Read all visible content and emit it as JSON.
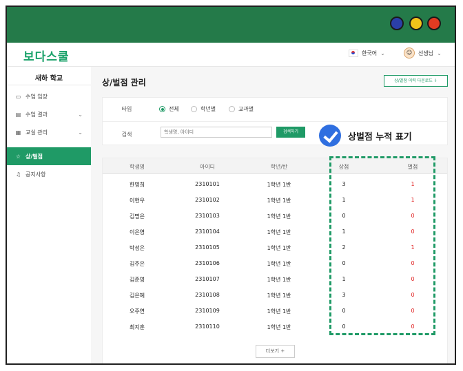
{
  "app": {
    "logo": "보다스쿨"
  },
  "header": {
    "language": "한국어",
    "user": "선생님"
  },
  "sidebar": {
    "school": "새하 학교",
    "items": [
      {
        "label": "수업 입장",
        "icon": "monitor-icon",
        "arrow": ""
      },
      {
        "label": "수업 결과",
        "icon": "clipboard-icon",
        "arrow": "⌄"
      },
      {
        "label": "교실 관리",
        "icon": "grid-icon",
        "arrow": "⌄"
      },
      {
        "label": "상/벌점",
        "icon": "star-icon",
        "arrow": "",
        "active": true
      },
      {
        "label": "공지사항",
        "icon": "bell-icon",
        "arrow": ""
      }
    ]
  },
  "main": {
    "title": "상/벌점 관리",
    "download_label": "상/벌점 이력 다운로드 ⇩",
    "filter": {
      "type_label": "타입",
      "options": [
        "전체",
        "학년별",
        "교과별"
      ],
      "selected": "전체",
      "search_label": "검색",
      "search_placeholder": "학생명, 아이디",
      "search_button": "검색하기"
    },
    "callout": "상벌점 누적 표기",
    "table": {
      "headers": [
        "학생명",
        "아이디",
        "학년/반",
        "상점",
        "벌점"
      ],
      "rows": [
        [
          "한명희",
          "2310101",
          "1학년 1반",
          "3",
          "1"
        ],
        [
          "이현우",
          "2310102",
          "1학년 1반",
          "1",
          "1"
        ],
        [
          "김명은",
          "2310103",
          "1학년 1반",
          "0",
          "0"
        ],
        [
          "이은영",
          "2310104",
          "1학년 1반",
          "1",
          "0"
        ],
        [
          "박성은",
          "2310105",
          "1학년 1반",
          "2",
          "1"
        ],
        [
          "김주은",
          "2310106",
          "1학년 1반",
          "0",
          "0"
        ],
        [
          "김준영",
          "2310107",
          "1학년 1반",
          "1",
          "0"
        ],
        [
          "김은혜",
          "2310108",
          "1학년 1반",
          "3",
          "0"
        ],
        [
          "오주연",
          "2310109",
          "1학년 1반",
          "0",
          "0"
        ],
        [
          "최지훈",
          "2310110",
          "1학년 1반",
          "0",
          "0"
        ]
      ],
      "more_label": "더보기 +"
    }
  },
  "colors": {
    "brand": "#1f9a66",
    "titlebar": "#247a49",
    "penalty": "#e02020",
    "check": "#2f6fe0"
  }
}
